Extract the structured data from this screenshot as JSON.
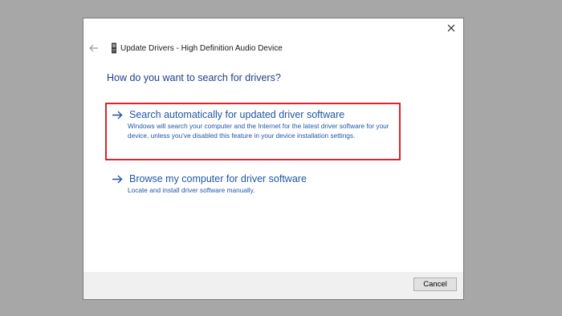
{
  "window": {
    "title": "Update Drivers - High Definition Audio Device",
    "close_icon": "close-icon",
    "back_icon": "back-arrow-icon",
    "device_icon": "audio-device-icon"
  },
  "main": {
    "question": "How do you want to search for drivers?",
    "options": [
      {
        "title": "Search automatically for updated driver software",
        "description": "Windows will search your computer and the Internet for the latest driver software for your device, unless you've disabled this feature in your device installation settings.",
        "icon": "arrow-right-icon",
        "highlighted": true
      },
      {
        "title": "Browse my computer for driver software",
        "description": "Locate and install driver software manually.",
        "icon": "arrow-right-icon",
        "highlighted": false
      }
    ]
  },
  "footer": {
    "cancel_label": "Cancel"
  },
  "colors": {
    "link_blue": "#1e56a8",
    "heading_blue": "#1e3f8a",
    "highlight_red": "#d9252b",
    "backdrop": "#a7a7a7"
  }
}
